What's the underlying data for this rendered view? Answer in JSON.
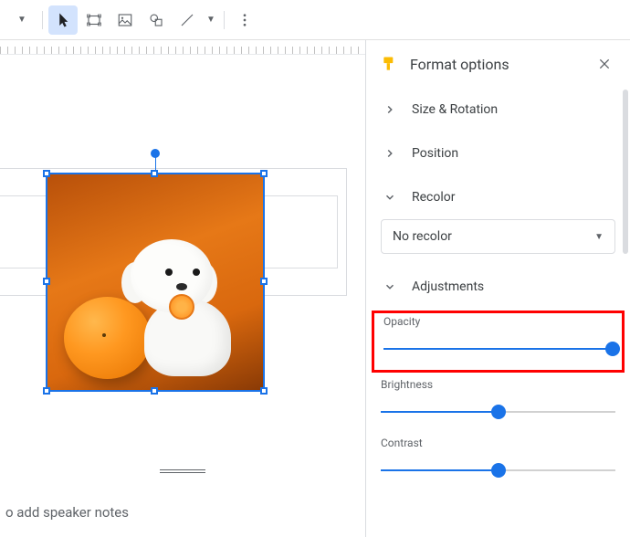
{
  "sidebar": {
    "title": "Format options",
    "sections": {
      "size_rotation": "Size & Rotation",
      "position": "Position",
      "recolor": "Recolor",
      "adjustments": "Adjustments"
    },
    "recolor_select": "No recolor",
    "adjustments": {
      "opacity": {
        "label": "Opacity",
        "value": 100
      },
      "brightness": {
        "label": "Brightness",
        "value": 50
      },
      "contrast": {
        "label": "Contrast",
        "value": 50
      }
    }
  },
  "notes": {
    "placeholder": "o add speaker notes"
  },
  "colors": {
    "accent": "#1a73e8",
    "highlight": "#ff0000"
  }
}
